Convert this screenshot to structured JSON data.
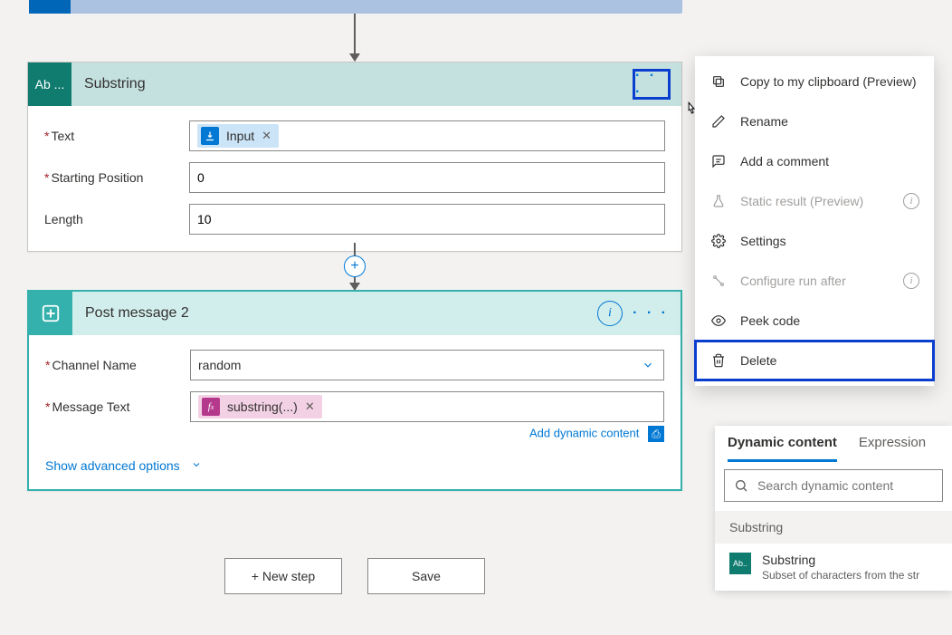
{
  "cards": {
    "substring": {
      "icon_label": "Ab ...",
      "title": "Substring",
      "fields": {
        "text": {
          "label": "Text",
          "token_label": "Input"
        },
        "start": {
          "label": "Starting Position",
          "value": "0"
        },
        "length": {
          "label": "Length",
          "value": "10"
        }
      }
    },
    "post": {
      "title": "Post message 2",
      "fields": {
        "channel": {
          "label": "Channel Name",
          "value": "random"
        },
        "message": {
          "label": "Message Text",
          "token_label": "substring(...)"
        }
      },
      "add_dynamic": "Add dynamic content",
      "show_advanced": "Show advanced options"
    }
  },
  "context_menu": {
    "copy": "Copy to my clipboard (Preview)",
    "rename": "Rename",
    "comment": "Add a comment",
    "static": "Static result (Preview)",
    "settings": "Settings",
    "configure": "Configure run after",
    "peek": "Peek code",
    "delete": "Delete"
  },
  "buttons": {
    "newstep": "+ New step",
    "save": "Save"
  },
  "dyn_panel": {
    "tab1": "Dynamic content",
    "tab2": "Expression",
    "search_placeholder": "Search dynamic content",
    "group": "Substring",
    "item_title": "Substring",
    "item_desc": "Subset of characters from the str"
  }
}
